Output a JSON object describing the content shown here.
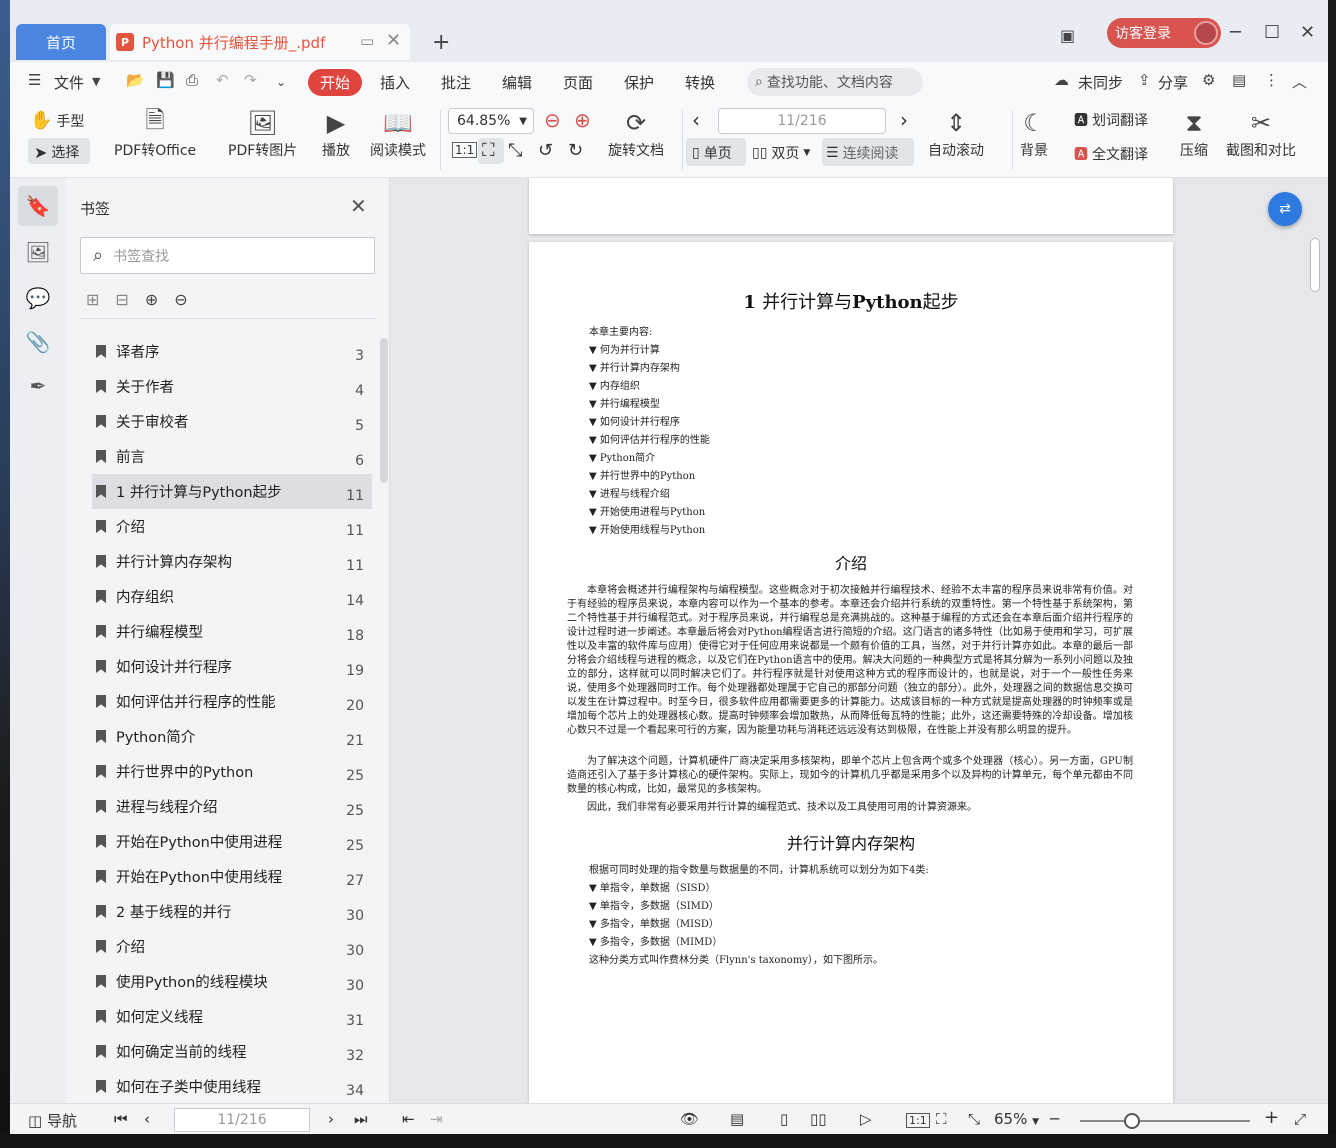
{
  "titlebar": {
    "home_tab": "首页",
    "doc_tab": "Python 并行编程手册_.pdf",
    "new_tab": "+",
    "login": "访客登录"
  },
  "menu": {
    "file": "文件",
    "items": [
      "开始",
      "插入",
      "批注",
      "编辑",
      "页面",
      "保护",
      "转换"
    ],
    "search_placeholder": "查找功能、文档内容",
    "sync": "未同步",
    "share": "分享"
  },
  "toolbar": {
    "hand": "手型",
    "select": "选择",
    "pdf_office": "PDF转Office",
    "pdf_image": "PDF转图片",
    "play": "播放",
    "read_mode": "阅读模式",
    "zoom": "64.85%",
    "rotate": "旋转文档",
    "page_current": "11/216",
    "single": "单页",
    "double": "双页",
    "continuous": "连续阅读",
    "autoscroll": "自动滚动",
    "background": "背景",
    "word_translate": "划词翻译",
    "full_translate": "全文翻译",
    "compress": "压缩",
    "screenshot": "截图和对比"
  },
  "bookmarks": {
    "title": "书签",
    "search_placeholder": "书签查找",
    "items": [
      {
        "label": "译者序",
        "page": "3"
      },
      {
        "label": "关于作者",
        "page": "4"
      },
      {
        "label": "关于审校者",
        "page": "5"
      },
      {
        "label": "前言",
        "page": "6"
      },
      {
        "label": "1 并行计算与Python起步",
        "page": "11"
      },
      {
        "label": "介绍",
        "page": "11"
      },
      {
        "label": "并行计算内存架构",
        "page": "11"
      },
      {
        "label": "内存组织",
        "page": "14"
      },
      {
        "label": "并行编程模型",
        "page": "18"
      },
      {
        "label": "如何设计并行程序",
        "page": "19"
      },
      {
        "label": "如何评估并行程序的性能",
        "page": "20"
      },
      {
        "label": "Python简介",
        "page": "21"
      },
      {
        "label": "并行世界中的Python",
        "page": "25"
      },
      {
        "label": "进程与线程介绍",
        "page": "25"
      },
      {
        "label": "开始在Python中使用进程",
        "page": "25"
      },
      {
        "label": "开始在Python中使用线程",
        "page": "27"
      },
      {
        "label": "2 基于线程的并行",
        "page": "30"
      },
      {
        "label": "介绍",
        "page": "30"
      },
      {
        "label": "使用Python的线程模块",
        "page": "30"
      },
      {
        "label": "如何定义线程",
        "page": "31"
      },
      {
        "label": "如何确定当前的线程",
        "page": "32"
      },
      {
        "label": "如何在子类中使用线程",
        "page": "34"
      }
    ]
  },
  "document": {
    "chapter_title_num": "1 ",
    "chapter_title_a": "并行计算与",
    "chapter_title_b": "Python",
    "chapter_title_c": "起步",
    "contents_label": "本章主要内容:",
    "contents": [
      "▼ 何为并行计算",
      "▼ 并行计算内存架构",
      "▼ 内存组织",
      "▼ 并行编程模型",
      "▼ 如何设计并行程序",
      "▼ 如何评估并行程序的性能",
      "▼ Python简介",
      "▼ 并行世界中的Python",
      "▼ 进程与线程介绍",
      "▼ 开始使用进程与Python",
      "▼ 开始使用线程与Python"
    ],
    "section1": "介绍",
    "para1": "本章将会概述并行编程架构与编程模型。这些概念对于初次接触并行编程技术、经验不太丰富的程序员来说非常有价值。对于有经验的程序员来说，本章内容可以作为一个基本的参考。本章还会介绍并行系统的双重特性。第一个特性基于系统架构，第二个特性基于并行编程范式。对于程序员来说，并行编程总是充满挑战的。这种基于编程的方式还会在本章后面介绍并行程序的设计过程时进一步阐述。本章最后将会对Python编程语言进行简短的介绍。这门语言的诸多特性（比如易于使用和学习，可扩展性以及丰富的软件库与应用）使得它对于任何应用来说都是一个颇有价值的工具，当然，对于并行计算亦如此。本章的最后一部分将会介绍线程与进程的概念，以及它们在Python语言中的使用。解决大问题的一种典型方式是将其分解为一系列小问题以及独立的部分，这样就可以同时解决它们了。并行程序就是针对使用这种方式的程序而设计的，也就是说，对于一个一般性任务来说，使用多个处理器同时工作。每个处理器都处理属于它自己的那部分问题（独立的部分）。此外，处理器之间的数据信息交换可以发生在计算过程中。时至今日，很多软件应用都需要更多的计算能力。达成该目标的一种方式就是提高处理器的时钟频率或是增加每个芯片上的处理器核心数。提高时钟频率会增加散热，从而降低每瓦特的性能；此外，这还需要特殊的冷却设备。增加核心数只不过是一个看起来可行的方案，因为能量功耗与消耗还远远没有达到极限，在性能上并没有那么明显的提升。",
    "para2": "为了解决这个问题，计算机硬件厂商决定采用多核架构，即单个芯片上包含两个或多个处理器（核心）。另一方面，GPU制造商还引入了基于多计算核心的硬件架构。实际上，现如今的计算机几乎都是采用多个以及异构的计算单元，每个单元都由不同数量的核心构成，比如，最常见的多核架构。",
    "para3": "因此，我们非常有必要采用并行计算的编程范式、技术以及工具使用可用的计算资源来。",
    "section2": "并行计算内存架构",
    "para4": "根据可同时处理的指令数量与数据量的不同，计算机系统可以划分为如下4类:",
    "list2": [
      "▼ 单指令，单数据（SISD）",
      "▼ 单指令，多数据（SIMD）",
      "▼ 多指令，单数据（MISD）",
      "▼ 多指令，多数据（MIMD）"
    ],
    "para5": "这种分类方式叫作费林分类（Flynn's taxonomy），如下图所示。"
  },
  "statusbar": {
    "nav": "导航",
    "page": "11/216",
    "zoom": "65%"
  }
}
